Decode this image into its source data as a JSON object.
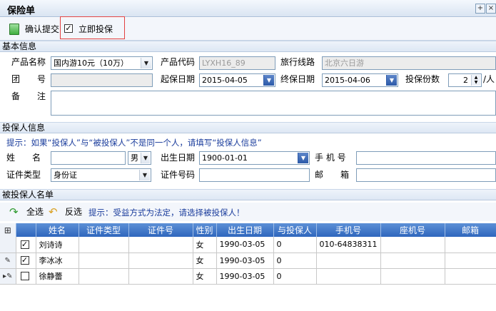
{
  "window": {
    "title": "保险单",
    "pin_glyph": "+",
    "close_glyph": "×"
  },
  "toolbar": {
    "confirm_label": "确认提交",
    "instant_checked": "✓",
    "instant_label": "立即投保"
  },
  "basic": {
    "section_title": "基本信息",
    "product_name_label": "产品名称",
    "product_name_value": "国内游10元（10万）",
    "product_code_label": "产品代码",
    "product_code_value": "LYXH16_89",
    "route_label": "旅行线路",
    "route_value": "北京六日游",
    "group_label": "团　　号",
    "group_value": "",
    "start_date_label": "起保日期",
    "start_date_value": "2015-04-05",
    "end_date_label": "终保日期",
    "end_date_value": "2015-04-06",
    "copies_label": "投保份数",
    "copies_value": "2",
    "copies_unit": "/人",
    "remark_label": "备　　注",
    "remark_value": ""
  },
  "applicant": {
    "section_title": "投保人信息",
    "hint": "提示：如果“投保人”与“被投保人”不是同一个人，请填写“投保人信息”",
    "name_label": "姓　　名",
    "name_value": "",
    "gender_value": "男",
    "birth_label": "出生日期",
    "birth_value": "1900-01-01",
    "mobile_label": "手 机 号",
    "mobile_value": "",
    "idtype_label": "证件类型",
    "idtype_value": "身份证",
    "idno_label": "证件号码",
    "idno_value": "",
    "mail_label": "邮　　箱",
    "mail_value": ""
  },
  "insured": {
    "section_title": "被投保人名单",
    "select_all_label": "全选",
    "invert_label": "反选",
    "hint": "提示：受益方式为法定，请选择被投保人！",
    "columns": [
      "姓名",
      "证件类型",
      "证件号",
      "性别",
      "出生日期",
      "与投保人",
      "手机号",
      "座机号",
      "邮箱"
    ],
    "rows": [
      {
        "marker": "",
        "checked": "✓",
        "name": "刘诗诗",
        "idtype": "",
        "idno": "",
        "gender": "女",
        "birth": "1990-03-05",
        "relation": "0",
        "mobile": "010-64838311",
        "phone": "",
        "email": ""
      },
      {
        "marker": "✎",
        "checked": "✓",
        "name": "李冰冰",
        "idtype": "",
        "idno": "",
        "gender": "女",
        "birth": "1990-03-05",
        "relation": "0",
        "mobile": "",
        "phone": "",
        "email": ""
      },
      {
        "marker": "▸✎",
        "checked": "",
        "name": "徐静蕾",
        "idtype": "",
        "idno": "",
        "gender": "女",
        "birth": "1990-03-05",
        "relation": "0",
        "mobile": "",
        "phone": "",
        "email": ""
      }
    ]
  }
}
